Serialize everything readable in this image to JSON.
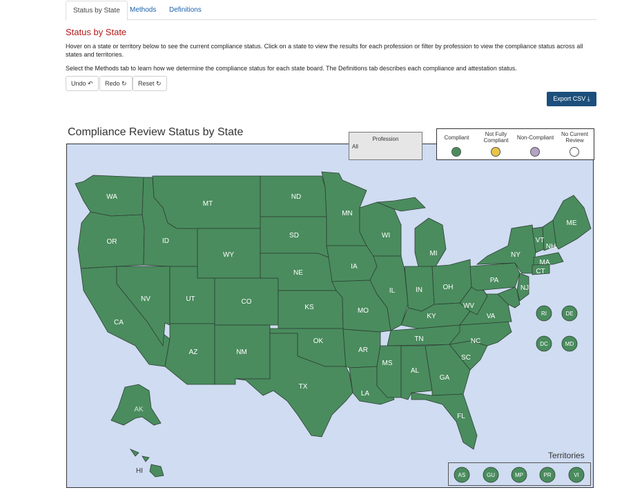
{
  "tabs": [
    {
      "label": "Status by State",
      "active": true
    },
    {
      "label": "Methods",
      "active": false
    },
    {
      "label": "Definitions",
      "active": false
    }
  ],
  "page": {
    "title": "Status by State",
    "para1": "Hover on a state or territory below to see the current compliance status. Click on a state to view the results for each profession or filter by profession to view the compliance status across all states and territories.",
    "para2": "Select the Methods tab to learn how we determine the compliance status for each state board. The Definitions tab describes each compliance and attestation status."
  },
  "toolbar": {
    "undo_label": "Undo ↶",
    "redo_label": "Redo ↻",
    "reset_label": "Reset ↻",
    "export_label": "Export CSV ⤓"
  },
  "map": {
    "title": "Compliance Review Status by State",
    "profession_label": "Profession",
    "profession_value": "All",
    "territories_label": "Territories",
    "fill_color": "#4a8c5e",
    "water_color": "#cfdcf1"
  },
  "legend": [
    {
      "label": "Compliant",
      "color": "#4a8c5e"
    },
    {
      "label": "Not Fully Compliant",
      "color": "#e8c447"
    },
    {
      "label": "Non-Compliant",
      "color": "#b3a3c4"
    },
    {
      "label": "No Current Review",
      "color": "#ffffff"
    }
  ],
  "states": [
    "WA",
    "OR",
    "CA",
    "ID",
    "NV",
    "MT",
    "WY",
    "UT",
    "AZ",
    "CO",
    "NM",
    "ND",
    "SD",
    "NE",
    "KS",
    "OK",
    "TX",
    "MN",
    "IA",
    "MO",
    "AR",
    "LA",
    "WI",
    "IL",
    "MI",
    "IN",
    "KY",
    "TN",
    "MS",
    "AL",
    "OH",
    "WV",
    "VA",
    "NC",
    "SC",
    "GA",
    "FL",
    "PA",
    "NY",
    "NJ",
    "VT",
    "NH",
    "ME",
    "MA",
    "CT",
    "AK",
    "HI"
  ],
  "small_states": [
    "RI",
    "DE",
    "DC",
    "MD"
  ],
  "territories": [
    "AS",
    "GU",
    "MP",
    "PR",
    "VI"
  ]
}
